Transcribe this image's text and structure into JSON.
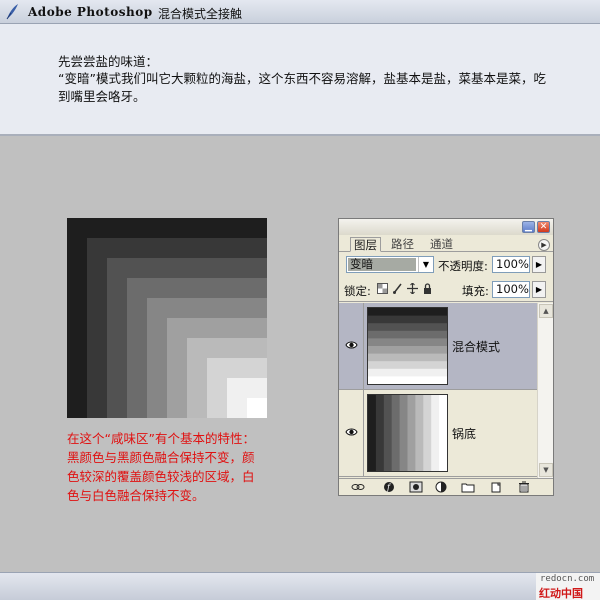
{
  "header": {
    "app_name": "Adobe Photoshop",
    "subtitle": "混合模式全接触"
  },
  "intro": {
    "heading": "先尝尝盐的味道：",
    "body": "“变暗”模式我们叫它大颗粒的海盐，这个东西不容易溶解，盐基本是盐，菜基本是菜，吃到嘴里会咯牙。"
  },
  "note": {
    "lines": [
      "在这个“咸味区”有个基本的特性：",
      "黑颜色与黑颜色融合保持不变，颜",
      "色较深的覆盖颜色较浅的区域，白",
      "色与白色融合保持不变。"
    ],
    "color": "#e01010"
  },
  "staircase": {
    "shades": [
      "#1e1e1e",
      "#383838",
      "#525252",
      "#6c6c6c",
      "#868686",
      "#a0a0a0",
      "#bababa",
      "#d4d4d4",
      "#f0f0f0",
      "#ffffff"
    ]
  },
  "panel": {
    "tabs": [
      {
        "label": "图层",
        "active": true
      },
      {
        "label": "路径",
        "active": false
      },
      {
        "label": "通道",
        "active": false
      }
    ],
    "blend_mode": "变暗",
    "opacity_label": "不透明度:",
    "opacity_value": "100%",
    "lock_label": "锁定:",
    "fill_label": "填充:",
    "fill_value": "100%",
    "layers": [
      {
        "name": "混合模式",
        "selected": true,
        "gradient": "horizontal"
      },
      {
        "name": "锅底",
        "selected": false,
        "gradient": "vertical"
      }
    ],
    "tool_icons": [
      "link-icon",
      "layer-style-icon",
      "mask-icon",
      "adjustment-icon",
      "folder-icon",
      "new-layer-icon",
      "trash-icon"
    ]
  },
  "footer": {
    "watermark_url": "redocn.com",
    "watermark_name": "红动中国"
  }
}
